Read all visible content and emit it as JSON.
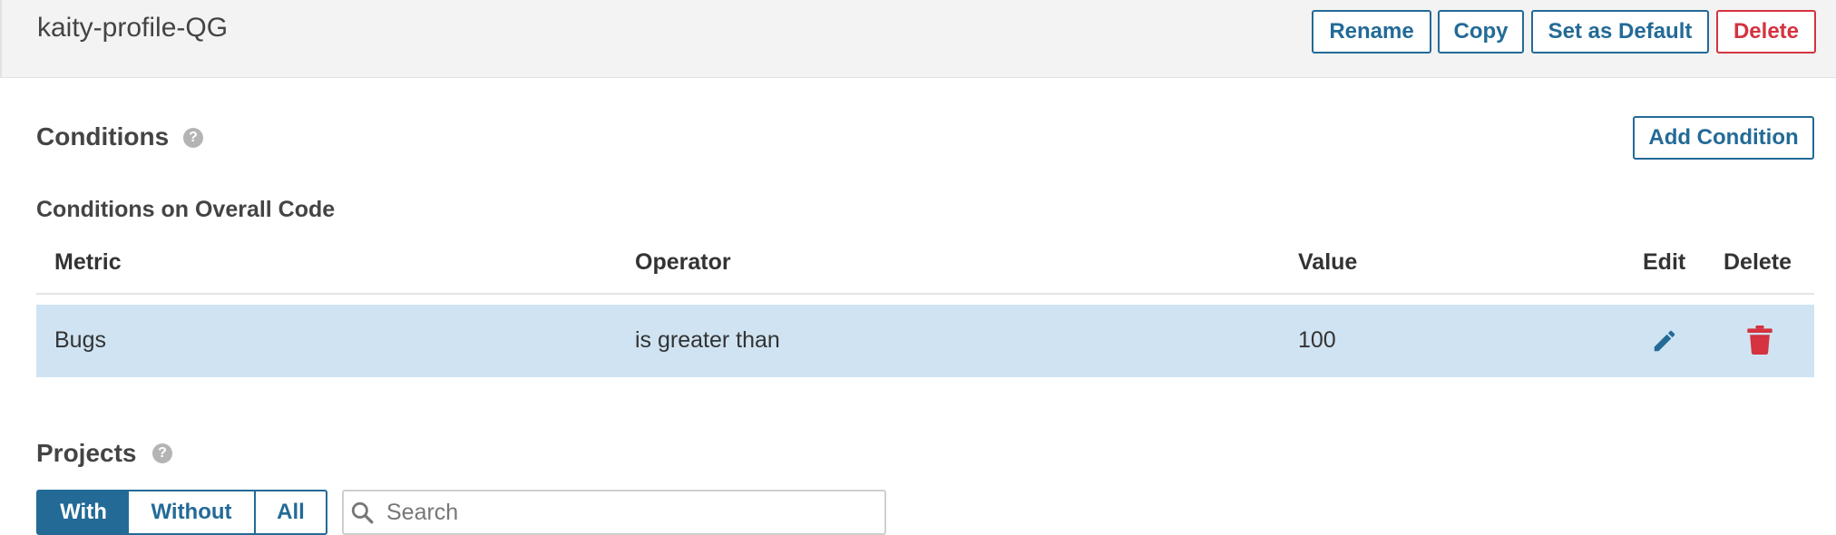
{
  "header": {
    "profile_name": "kaity-profile-QG",
    "rename_label": "Rename",
    "copy_label": "Copy",
    "set_default_label": "Set as Default",
    "delete_label": "Delete"
  },
  "conditions": {
    "title": "Conditions",
    "help_icon": "?",
    "add_condition_label": "Add Condition",
    "overall_code_title": "Conditions on Overall Code",
    "columns": {
      "metric": "Metric",
      "operator": "Operator",
      "value": "Value",
      "edit": "Edit",
      "delete": "Delete"
    },
    "rows": [
      {
        "metric": "Bugs",
        "operator": "is greater than",
        "value": "100",
        "edit_icon": "pencil-icon",
        "delete_icon": "trash-icon"
      }
    ]
  },
  "projects": {
    "title": "Projects",
    "help_icon": "?",
    "filter_with": "With",
    "filter_without": "Without",
    "filter_all": "All",
    "selected_filter": "With",
    "search_placeholder": "Search"
  },
  "colors": {
    "accent": "#236a97",
    "danger": "#d4333f",
    "row_highlight": "#cfe3f2",
    "header_bg": "#f3f3f3"
  }
}
